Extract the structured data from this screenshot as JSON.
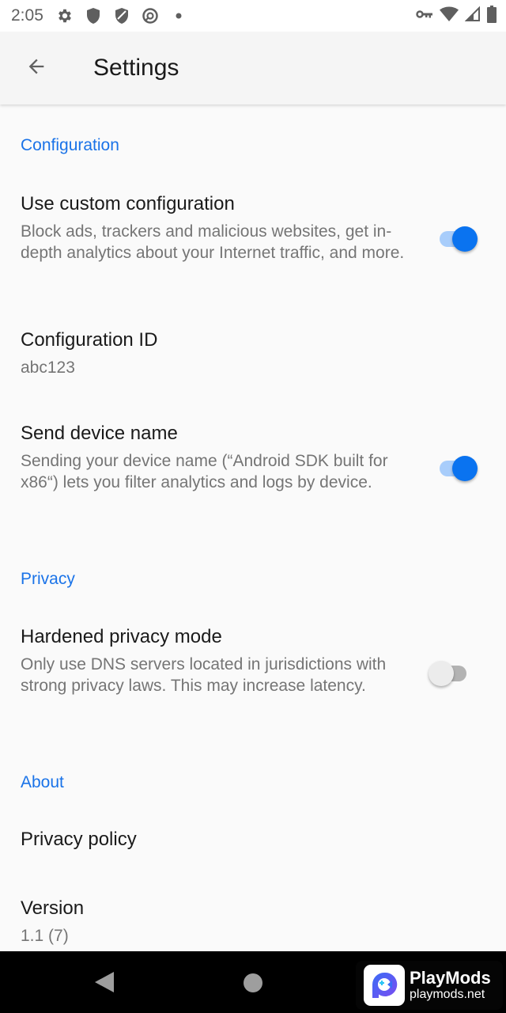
{
  "status_bar": {
    "time": "2:05",
    "left_icons": [
      "gear-icon",
      "shield-icon",
      "shield-striped-icon",
      "no-data-saver-icon",
      "dot-icon"
    ],
    "right_icons": [
      "vpn-key-icon",
      "wifi-icon",
      "cell-signal-icon",
      "battery-icon"
    ]
  },
  "app_bar": {
    "back_icon": "arrow-back-icon",
    "title": "Settings"
  },
  "sections": [
    {
      "header": "Configuration",
      "items": [
        {
          "title": "Use custom configuration",
          "summary": "Block ads, trackers and malicious websites, get in-depth analytics about your Internet traffic, and more.",
          "switch": true
        },
        {
          "title": "Configuration ID",
          "summary": "abc123"
        },
        {
          "title": "Send device name",
          "summary": "Sending your device name (“Android SDK built for x86“) lets you filter analytics and logs by device.",
          "switch": true
        }
      ]
    },
    {
      "header": "Privacy",
      "items": [
        {
          "title": "Hardened privacy mode",
          "summary": "Only use DNS servers located in jurisdictions with strong privacy laws. This may increase latency.",
          "switch": false
        }
      ]
    },
    {
      "header": "About",
      "items": [
        {
          "title": "Privacy policy"
        },
        {
          "title": "Version",
          "summary": "1.1 (7)"
        }
      ]
    }
  ],
  "nav_bar": {
    "back": "nav-back-icon",
    "home": "nav-home-icon"
  },
  "watermark": {
    "name": "PlayMods",
    "url": "playmods.net"
  },
  "colors": {
    "accent": "#1a73e8",
    "switch_on_thumb": "#0a73f0",
    "switch_on_track": "#a8cdfb",
    "switch_off_thumb": "#ececec",
    "switch_off_track": "#b3b3b3",
    "background": "#fafafa"
  }
}
